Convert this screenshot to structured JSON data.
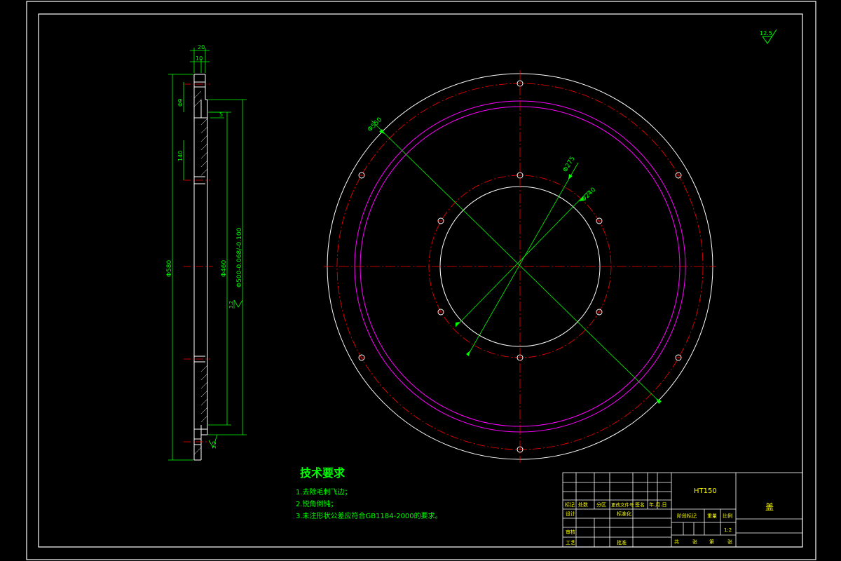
{
  "side_view": {
    "dims": {
      "top_outer": "20",
      "top_inner": "10",
      "hole_dia": "Φ9",
      "hole_pitch": "140",
      "step_depth": "5",
      "outer_dia": "Φ580",
      "bore_dia": "Φ460",
      "fit_dia": "Φ500-0.068/-0.100"
    },
    "roughness_mid": "3.2",
    "roughness_bottom": "3.2"
  },
  "top_roughness": "12.5",
  "front_view": {
    "dims": {
      "d_outer": "Φ550",
      "d_pcd": "Φ275",
      "d_inner": "Φ240"
    }
  },
  "tech_requirements": {
    "title": "技术要求",
    "items": [
      "1.去除毛刺飞边；",
      "2.锐角倒钝；",
      "3.未注形状公差应符合GB1184-2000的要求。"
    ]
  },
  "title_block": {
    "material": "HT150",
    "part_name": "盖",
    "header_row": [
      "标记",
      "处数",
      "分区",
      "更改文件号",
      "签名",
      "年.月.日"
    ],
    "design_label": "设计",
    "standardize_label": "标准化",
    "review_label": "审核",
    "process_label": "工艺",
    "approve_label": "批准",
    "stage_label": "阶段标记",
    "weight_label": "重量",
    "scale_label": "比例",
    "scale_value": "1:2",
    "sheet_labels": [
      "共",
      "张",
      "第",
      "张"
    ]
  }
}
